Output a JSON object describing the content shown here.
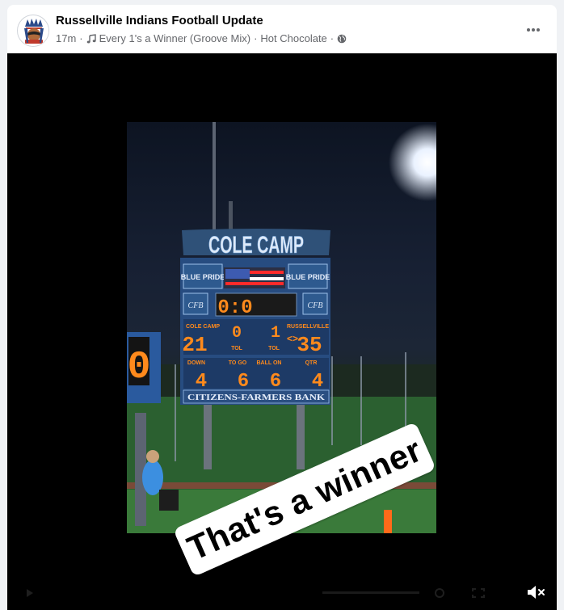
{
  "post": {
    "page_name": "Russellville Indians Football Update",
    "time": "17m",
    "song": "Every 1's a Winner (Groove Mix)",
    "song_artist": "Hot Chocolate",
    "privacy_icon": "globe-icon",
    "more_icon": "more-horizontal-icon"
  },
  "scoreboard": {
    "school": "COLE CAMP",
    "left_panel": "BLUE PRIDE",
    "right_panel": "BLUE PRIDE",
    "logo_left": "CFB",
    "logo_right": "CFB",
    "clock": "0:0",
    "home_label": "COLE CAMP",
    "home_score": "21",
    "home_tol": "0",
    "guest_tol": "1",
    "guest_label": "RUSSELLVILLE",
    "guest_score": "35",
    "tol_left": "TOL",
    "tol_right": "TOL",
    "down_label": "DOWN",
    "down_value": "4",
    "togo_label": "TO GO",
    "togo_value": "6",
    "ballon_label": "BALL ON",
    "ballon_value": "6",
    "qtr_label": "QTR",
    "qtr_value": "4",
    "sponsor": "CITIZENS-FARMERS BANK",
    "side_board_digit": "0"
  },
  "sticker": {
    "text": "That's a winner"
  },
  "video": {
    "mute_icon": "speaker-muted-icon"
  },
  "colors": {
    "led": "#ff8a1c",
    "board": "#274c80",
    "panel": "#2e4a72",
    "text_primary": "#050505",
    "text_secondary": "#65676b"
  }
}
